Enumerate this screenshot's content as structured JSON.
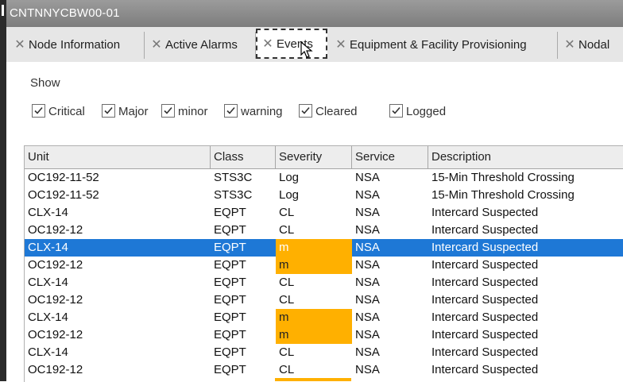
{
  "window": {
    "title": "CNTNNYCBW00-01"
  },
  "tabs": [
    {
      "label": "Node Information",
      "active": false
    },
    {
      "label": "Active Alarms",
      "active": false
    },
    {
      "label": "Events",
      "active": true
    },
    {
      "label": "Equipment & Facility Provisioning",
      "active": false
    },
    {
      "label": "Nodal",
      "active": false
    }
  ],
  "tab_close_glyph": "✕",
  "filters": {
    "show_label": "Show",
    "options": [
      {
        "label": "Critical",
        "checked": true
      },
      {
        "label": "Major",
        "checked": true
      },
      {
        "label": "minor",
        "checked": true
      },
      {
        "label": "warning",
        "checked": true
      },
      {
        "label": "Cleared",
        "checked": true
      },
      {
        "label": "Logged",
        "checked": true
      }
    ]
  },
  "table": {
    "columns": [
      "Unit",
      "Class",
      "Severity",
      "Service",
      "Description"
    ],
    "rows": [
      {
        "unit": "OC192-11-52",
        "class": "STS3C",
        "severity": "Log",
        "service": "NSA",
        "description": "15-Min Threshold Crossing",
        "highlight": false,
        "selected": false
      },
      {
        "unit": "OC192-11-52",
        "class": "STS3C",
        "severity": "Log",
        "service": "NSA",
        "description": "15-Min Threshold Crossing",
        "highlight": false,
        "selected": false
      },
      {
        "unit": "CLX-14",
        "class": "EQPT",
        "severity": "CL",
        "service": "NSA",
        "description": "Intercard Suspected",
        "highlight": false,
        "selected": false
      },
      {
        "unit": "OC192-12",
        "class": "EQPT",
        "severity": "CL",
        "service": "NSA",
        "description": "Intercard Suspected",
        "highlight": false,
        "selected": false
      },
      {
        "unit": "CLX-14",
        "class": "EQPT",
        "severity": "m",
        "service": "NSA",
        "description": "Intercard Suspected",
        "highlight": true,
        "selected": true
      },
      {
        "unit": "OC192-12",
        "class": "EQPT",
        "severity": "m",
        "service": "NSA",
        "description": "Intercard Suspected",
        "highlight": true,
        "selected": false
      },
      {
        "unit": "CLX-14",
        "class": "EQPT",
        "severity": "CL",
        "service": "NSA",
        "description": "Intercard Suspected",
        "highlight": false,
        "selected": false
      },
      {
        "unit": "OC192-12",
        "class": "EQPT",
        "severity": "CL",
        "service": "NSA",
        "description": "Intercard Suspected",
        "highlight": false,
        "selected": false
      },
      {
        "unit": "CLX-14",
        "class": "EQPT",
        "severity": "m",
        "service": "NSA",
        "description": "Intercard Suspected",
        "highlight": true,
        "selected": false
      },
      {
        "unit": "OC192-12",
        "class": "EQPT",
        "severity": "m",
        "service": "NSA",
        "description": "Intercard Suspected",
        "highlight": true,
        "selected": false
      },
      {
        "unit": "CLX-14",
        "class": "EQPT",
        "severity": "CL",
        "service": "NSA",
        "description": "Intercard Suspected",
        "highlight": false,
        "selected": false
      },
      {
        "unit": "OC192-12",
        "class": "EQPT",
        "severity": "CL",
        "service": "NSA",
        "description": "Intercard Suspected",
        "highlight": false,
        "selected": false
      }
    ]
  },
  "colors": {
    "selection": "#1e78d6",
    "minor_severity": "#ffb000",
    "titlebar": "#8a8a8a"
  }
}
